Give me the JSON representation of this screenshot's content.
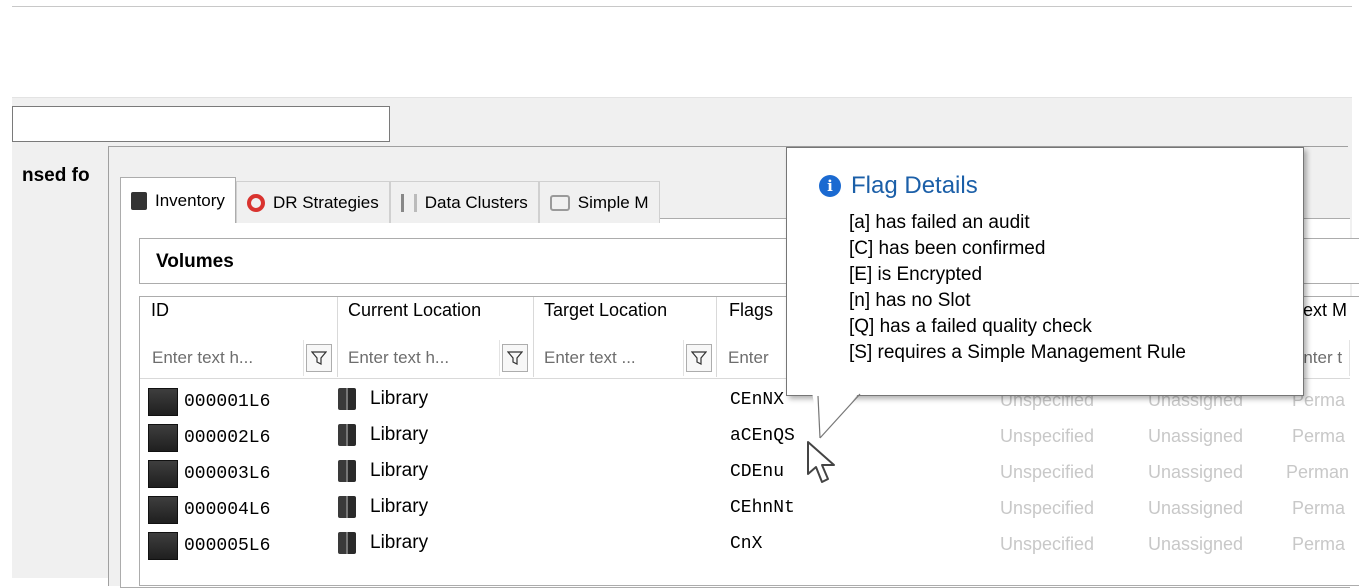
{
  "left_panel": {
    "label": "nsed fo"
  },
  "tabs": [
    {
      "label": "Inventory",
      "icon": "tape-icon"
    },
    {
      "label": "DR Strategies",
      "icon": "lifebuoy-icon"
    },
    {
      "label": "Data Clusters",
      "icon": "cluster-icon"
    },
    {
      "label": "Simple M",
      "icon": "management-icon"
    }
  ],
  "volumes_header": "Volumes",
  "columns": [
    {
      "label": "ID",
      "filter_placeholder": "Enter text h..."
    },
    {
      "label": "Current Location",
      "filter_placeholder": "Enter text h..."
    },
    {
      "label": "Target Location",
      "filter_placeholder": "Enter text ..."
    },
    {
      "label": "Flags",
      "filter_placeholder": "Enter"
    },
    {
      "label": "Next M",
      "filter_placeholder": "Enter t"
    }
  ],
  "rows": [
    {
      "id": "000001L6",
      "location": "Library",
      "flags": "CEnNX",
      "c1": "Unspecified",
      "c2": "Unassigned",
      "c3": "Perma"
    },
    {
      "id": "000002L6",
      "location": "Library",
      "flags": "aCEnQS",
      "c1": "Unspecified",
      "c2": "Unassigned",
      "c3": "Perma"
    },
    {
      "id": "000003L6",
      "location": "Library",
      "flags": "CDEnu",
      "c1": "Unspecified",
      "c2": "Unassigned",
      "c3": "Perman"
    },
    {
      "id": "000004L6",
      "location": "Library",
      "flags": "CEhnNt",
      "c1": "Unspecified",
      "c2": "Unassigned",
      "c3": "Perma"
    },
    {
      "id": "000005L6",
      "location": "Library",
      "flags": "CnX",
      "c1": "Unspecified",
      "c2": "Unassigned",
      "c3": "Perma"
    }
  ],
  "tooltip": {
    "title": "Flag Details",
    "lines": [
      "[a] has failed an audit",
      "[C] has been confirmed",
      "[E] is Encrypted",
      "[n] has no Slot",
      "[Q] has a failed quality check",
      "[S] requires a Simple Management Rule"
    ]
  },
  "colors": {
    "accent": "#1b5fa8",
    "muted": "#c8c8c8"
  }
}
